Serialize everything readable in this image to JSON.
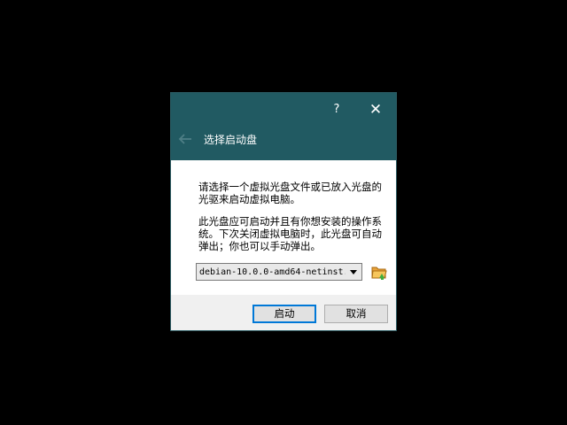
{
  "dialog": {
    "help_label": "?",
    "close_label": "✕",
    "title": "选择启动盘",
    "paragraph1": "请选择一个虚拟光盘文件或已放入光盘的光驱来启动虚拟电脑。",
    "paragraph2": "此光盘应可启动并且有你想安装的操作系统。下次关闭虚拟电脑时，此光盘可自动弹出；你也可以手动弹出。",
    "disk_select_value": "debian-10.0.0-amd64-netinst.",
    "start_button": "启动",
    "cancel_button": "取消"
  },
  "icons": {
    "back": "back-arrow-icon",
    "chevron": "chevron-down-icon",
    "folder": "folder-open-icon",
    "help": "help-icon",
    "close": "close-icon"
  },
  "colors": {
    "titlebar": "#215a62",
    "focus_border": "#0078d7"
  }
}
